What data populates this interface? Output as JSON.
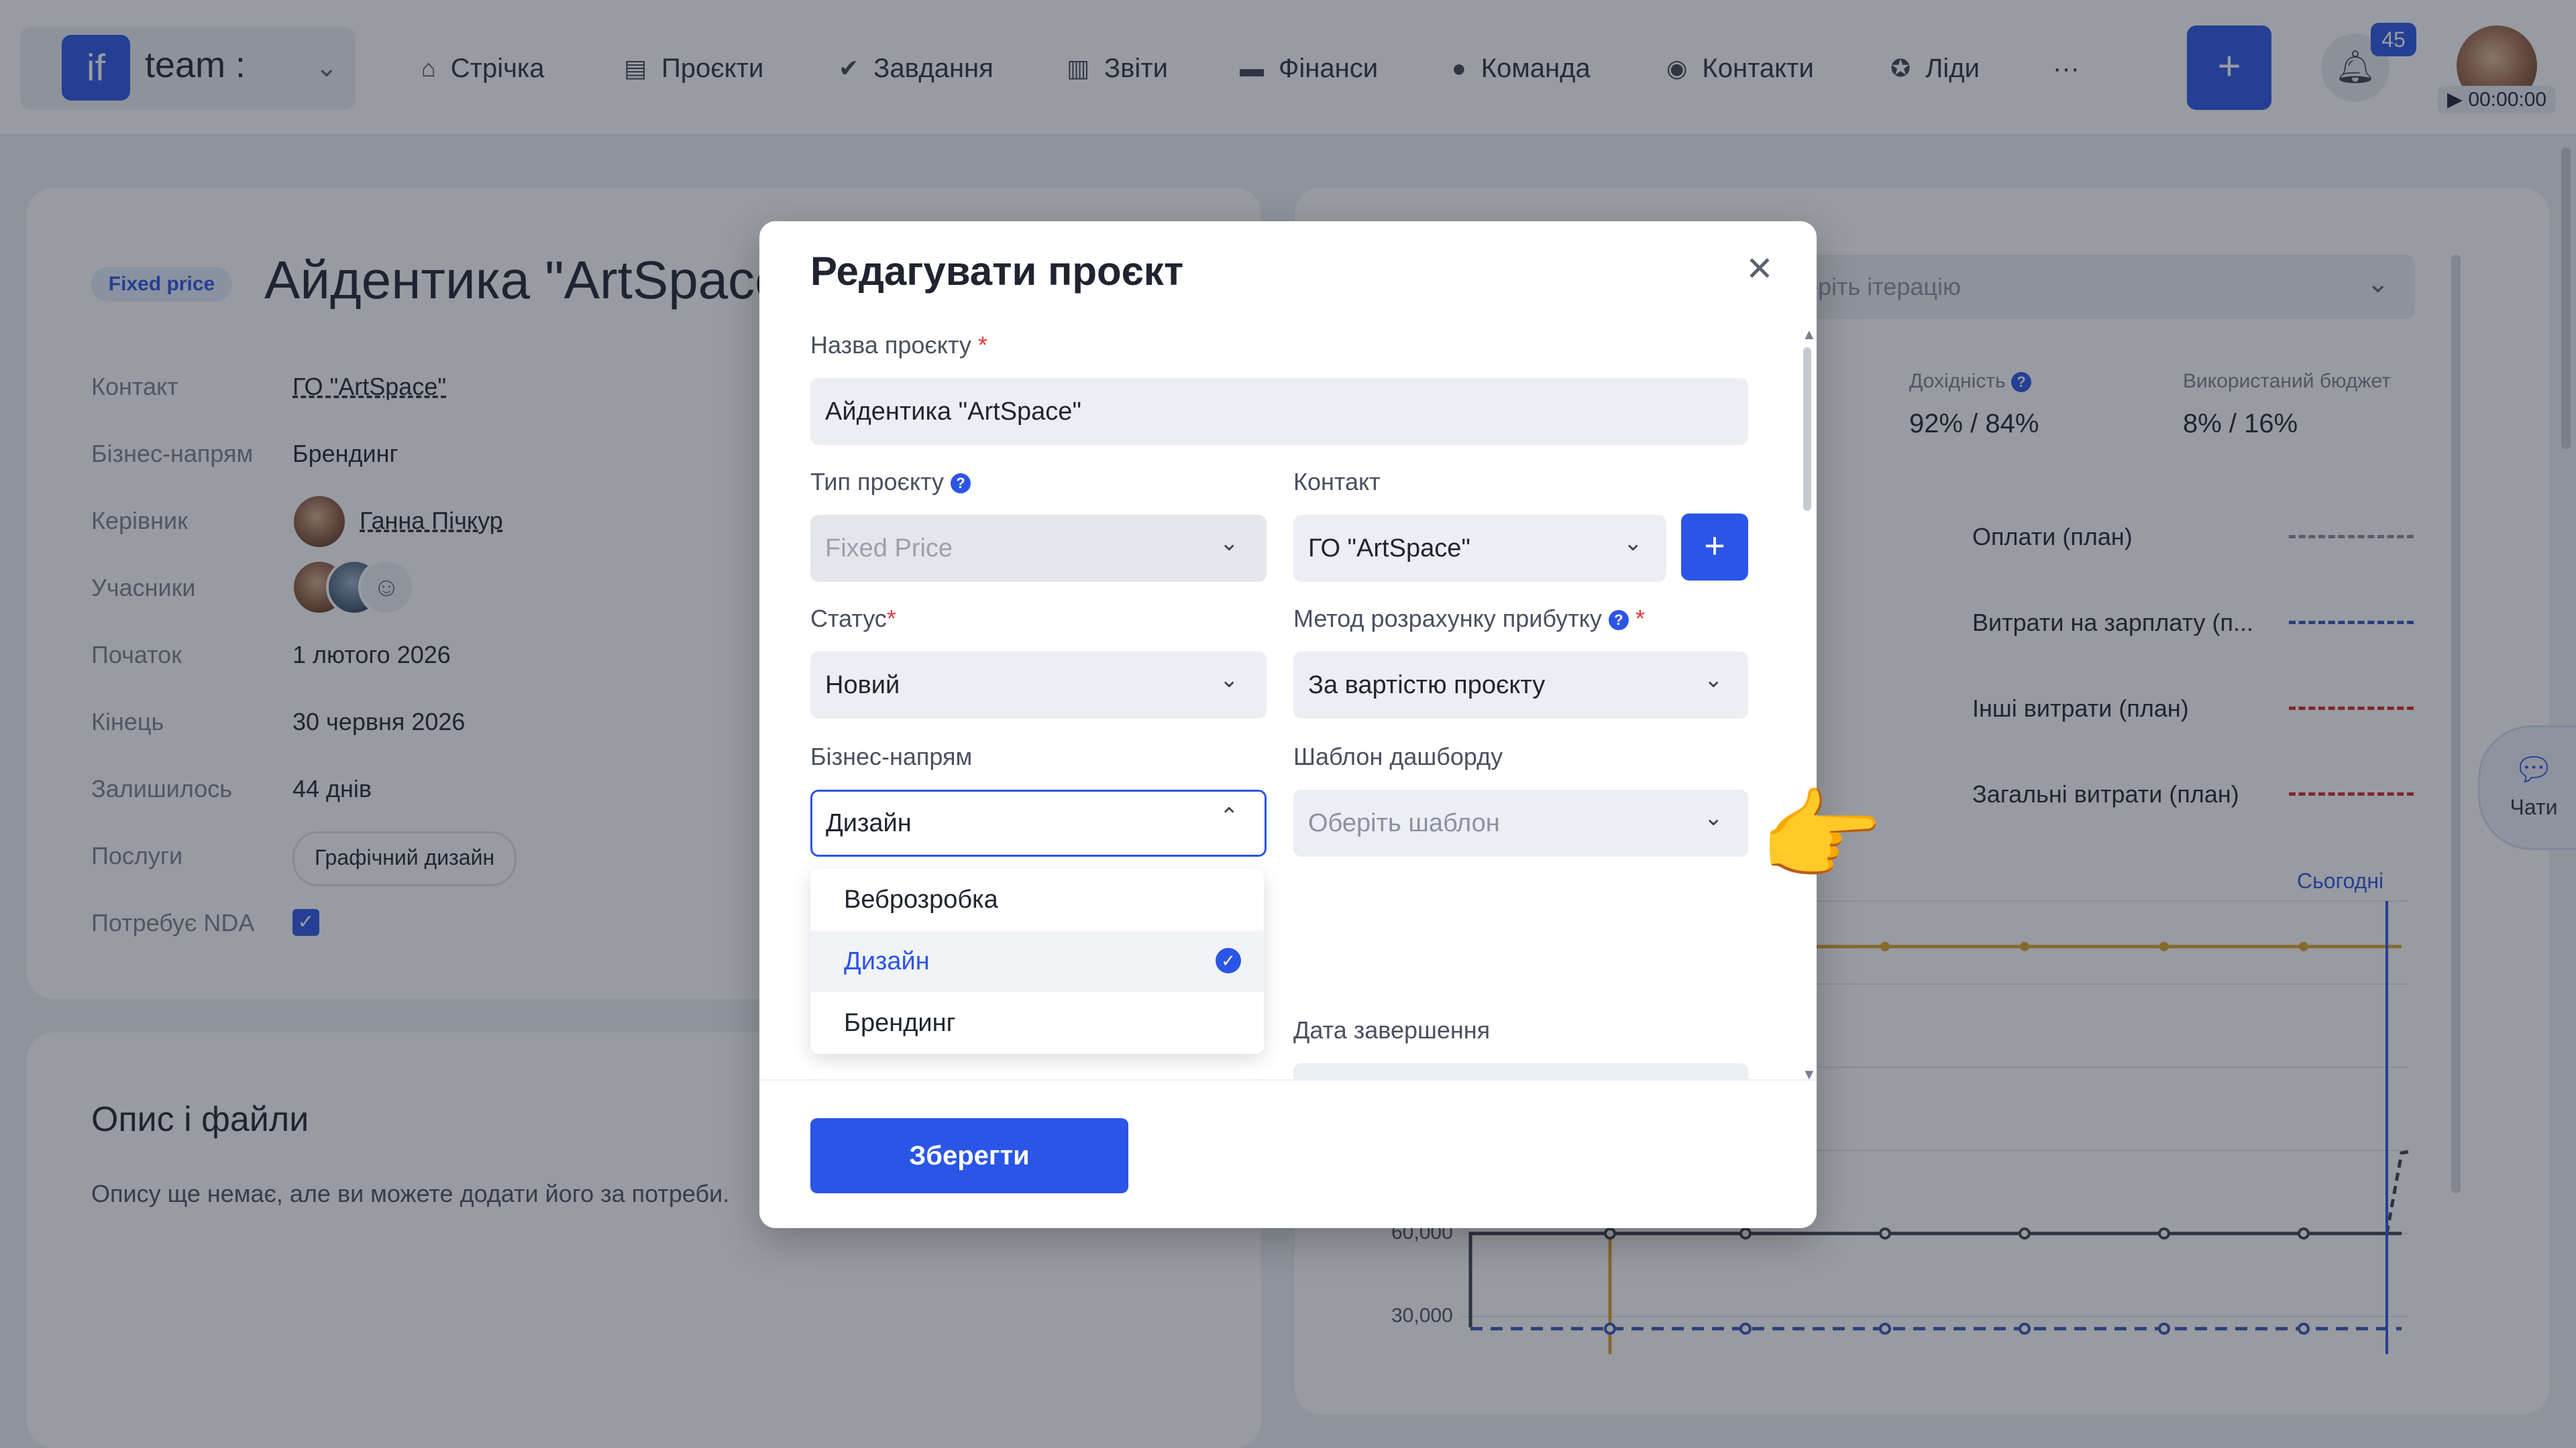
{
  "topbar": {
    "team_logo": "if",
    "team_name": "team :",
    "nav": [
      {
        "label": "Стрічка",
        "icon": "home-icon"
      },
      {
        "label": "Проєкти",
        "icon": "document-icon"
      },
      {
        "label": "Завдання",
        "icon": "check-circle-icon"
      },
      {
        "label": "Звіти",
        "icon": "chart-icon"
      },
      {
        "label": "Фінанси",
        "icon": "wallet-icon"
      },
      {
        "label": "Команда",
        "icon": "user-icon"
      },
      {
        "label": "Контакти",
        "icon": "contacts-icon"
      },
      {
        "label": "Ліди",
        "icon": "leads-icon"
      }
    ],
    "more": "···",
    "add": "+",
    "notifications_count": "45",
    "timer": "▶ 00:00:00"
  },
  "project": {
    "badge": "Fixed price",
    "title": "Айдентика \"ArtSpace",
    "fields": [
      {
        "label": "Контакт",
        "value": "ГО \"ArtSpace\""
      },
      {
        "label": "Бізнес-напрям",
        "value": "Брендинг"
      },
      {
        "label": "Керівник",
        "value": "Ганна Пічкур"
      },
      {
        "label": "Учасники",
        "value": ""
      },
      {
        "label": "Початок",
        "value": "1 лютого 2026"
      },
      {
        "label": "Кінець",
        "value": "30 червня 2026"
      },
      {
        "label": "Залишилось",
        "value": "44 днів"
      },
      {
        "label": "Послуги",
        "value": "Графічний дизайн"
      },
      {
        "label": "Потребує NDA",
        "value": ""
      }
    ],
    "description_title": "Опис і файли",
    "description_text": "Опису ще немає, але ви можете додати його за потреби."
  },
  "finance": {
    "iteration_placeholder": "еріть ітерацію",
    "metrics": [
      {
        "label": "Дохідність",
        "value": "92% / 84%"
      },
      {
        "label": "Використаний бюджет",
        "value": "8% / 16%"
      }
    ],
    "legend": [
      {
        "label": "Оплати (план)",
        "color": "#8a8f9c"
      },
      {
        "label": "Витрати на зарплату (п...",
        "color": "#3556b8"
      },
      {
        "label": "Інші витрати (план)",
        "color": "#d62626"
      },
      {
        "label": "Загальні витрати (план)",
        "color": "#d62626"
      }
    ],
    "today_label": "Сьогодні",
    "y_ticks": [
      "60,000",
      "30,000"
    ],
    "chat_label": "Чати"
  },
  "modal": {
    "title": "Редагувати проєкт",
    "name_label": "Назва проєкту",
    "name_value": "Айдентика \"ArtSpace\"",
    "type_label": "Тип проєкту",
    "type_value": "Fixed Price",
    "contact_label": "Контакт",
    "contact_value": "ГО \"ArtSpace\"",
    "status_label": "Статус",
    "status_value": "Новий",
    "profit_label": "Метод розрахунку прибутку",
    "profit_value": "За вартістю проєкту",
    "direction_label": "Бізнес-напрям",
    "direction_value": "Дизайн",
    "dashboard_label": "Шаблон дашборду",
    "dashboard_placeholder": "Оберіть шаблон",
    "end_date_label": "Дата завершення",
    "dropdown_options": [
      "Веброзробка",
      "Дизайн",
      "Брендинг"
    ],
    "selected_option": "Дизайн",
    "save_label": "Зберегти"
  },
  "colors": {
    "accent": "#2a55e6"
  }
}
